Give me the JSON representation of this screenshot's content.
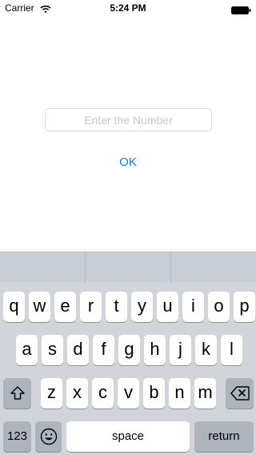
{
  "status_bar": {
    "carrier": "Carrier",
    "time": "5:24 PM"
  },
  "form": {
    "number_placeholder": "Enter the Number",
    "number_value": "",
    "ok_label": "OK",
    "accent_color": "#0a7aff"
  },
  "keyboard": {
    "rows": [
      [
        "q",
        "w",
        "e",
        "r",
        "t",
        "y",
        "u",
        "i",
        "o",
        "p"
      ],
      [
        "a",
        "s",
        "d",
        "f",
        "g",
        "h",
        "j",
        "k",
        "l"
      ],
      [
        "z",
        "x",
        "c",
        "v",
        "b",
        "n",
        "m"
      ]
    ],
    "shift_icon": "shift-arrow-icon",
    "delete_icon": "backspace-icon",
    "numbers_label": "123",
    "emoji_icon": "emoji-face-icon",
    "space_label": "space",
    "return_label": "return"
  }
}
